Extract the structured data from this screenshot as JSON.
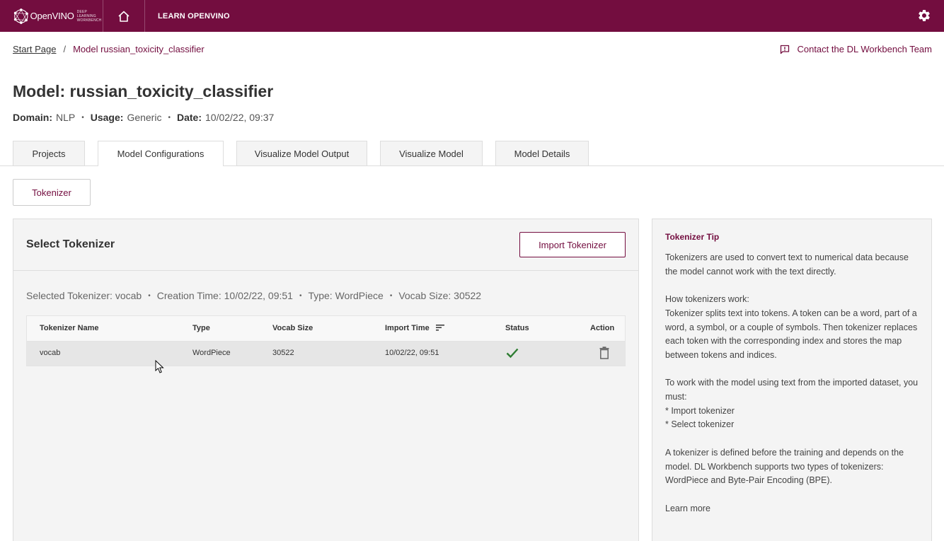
{
  "header": {
    "logo_text": "OpenVINO",
    "logo_subtext": "DEEP LEARNING WORKBENCH",
    "home_icon": "home-icon",
    "learn_label": "LEARN OPENVINO",
    "settings_icon": "gear-icon",
    "brand_color": "#730d3f"
  },
  "breadcrumb": {
    "start": "Start Page",
    "separator": "/",
    "current": "Model russian_toxicity_classifier"
  },
  "contact": {
    "icon": "feedback-icon",
    "label": "Contact the DL Workbench Team"
  },
  "page": {
    "title": "Model: russian_toxicity_classifier",
    "meta": {
      "domain_key": "Domain:",
      "domain_val": "NLP",
      "usage_key": "Usage:",
      "usage_val": "Generic",
      "date_key": "Date:",
      "date_val": "10/02/22, 09:37",
      "dot": "•"
    }
  },
  "tabs": [
    {
      "label": "Projects"
    },
    {
      "label": "Model Configurations",
      "active": true
    },
    {
      "label": "Visualize Model Output"
    },
    {
      "label": "Visualize Model"
    },
    {
      "label": "Model Details"
    }
  ],
  "subtab": {
    "label": "Tokenizer"
  },
  "tokenizer_panel": {
    "title": "Select Tokenizer",
    "import_label": "Import Tokenizer",
    "selected": {
      "name": "Selected Tokenizer: vocab",
      "created": "Creation Time: 10/02/22, 09:51",
      "type": "Type: WordPiece",
      "vocab": "Vocab Size: 30522",
      "dot": "•"
    },
    "table": {
      "headers": {
        "name": "Tokenizer Name",
        "type": "Type",
        "vocab": "Vocab Size",
        "import_time": "Import Time",
        "status": "Status",
        "action": "Action"
      },
      "rows": [
        {
          "name": "vocab",
          "type": "WordPiece",
          "vocab": "30522",
          "import_time": "10/02/22, 09:51",
          "status_icon": "check-icon",
          "action_icon": "trash-icon"
        }
      ],
      "status_color": "#2e7d32"
    }
  },
  "tip": {
    "title": "Tokenizer Tip",
    "p1": "Tokenizers are used to convert text to numerical data because the model cannot work with the text directly.",
    "p2_title": "How tokenizers work:",
    "p2": "Tokenizer splits text into tokens. A token can be a word, part of a word, a symbol, or a couple of symbols. Then tokenizer replaces each token with the corresponding index and stores the map between tokens and indices.",
    "p3": "To work with the model using text from the imported dataset, you must:",
    "p3_item1": "* Import tokenizer",
    "p3_item2": "* Select tokenizer",
    "p4": "A tokenizer is defined before the training and depends on the model. DL Workbench supports two types of tokenizers: WordPiece and Byte-Pair Encoding (BPE).",
    "learn_more": "Learn more"
  }
}
